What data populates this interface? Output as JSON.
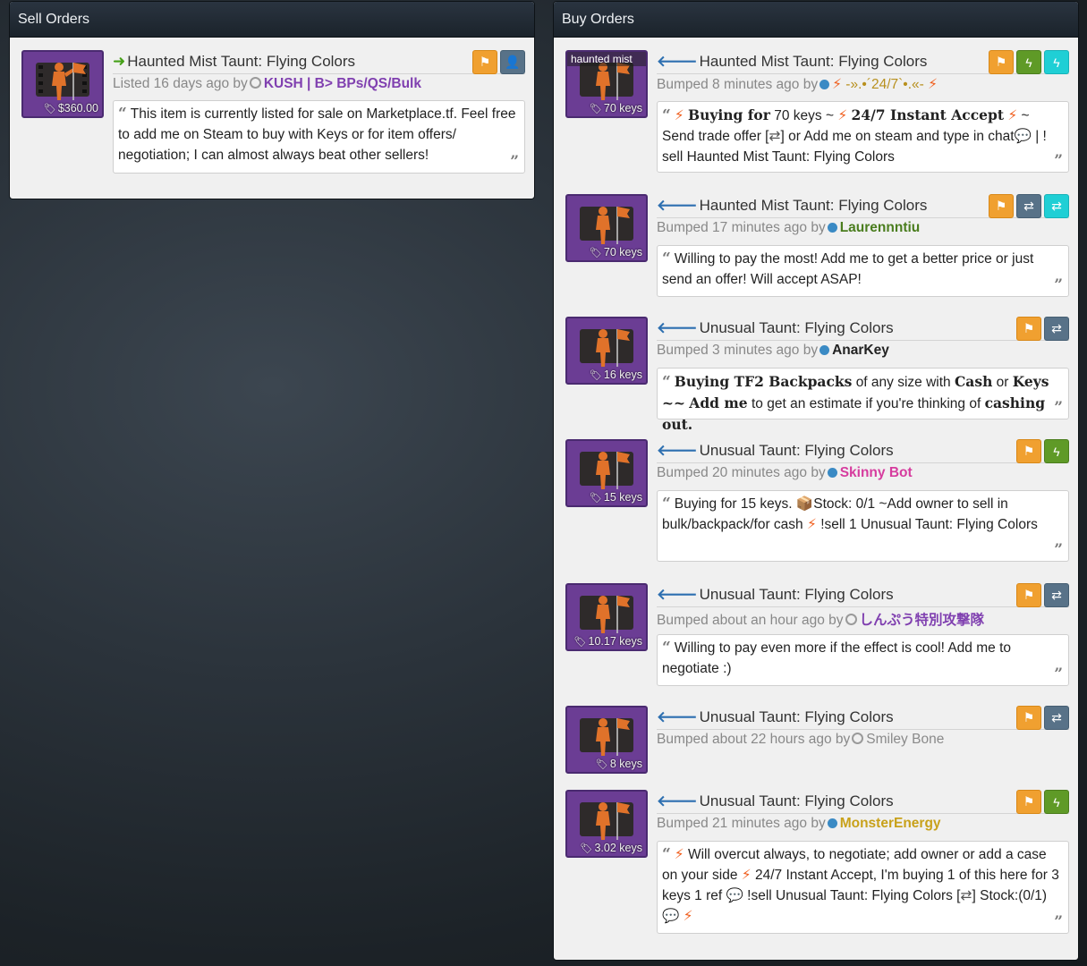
{
  "sell": {
    "header": "Sell Orders",
    "title": "Haunted Mist Taunt: Flying Colors",
    "price": "$360.00",
    "meta_prefix": "Listed 16 days ago by",
    "user": "KUSH | B> BPs/QS/Bulk",
    "description": "This item is currently listed for sale on Marketplace.tf. Feel free to add me on Steam to buy with Keys or for item offers/ negotiation; I can almost always beat other sellers!"
  },
  "buy": {
    "header": "Buy Orders",
    "l1": {
      "effect": "haunted mist",
      "title": "Haunted Mist Taunt: Flying Colors",
      "price": "70 keys",
      "meta_prefix": "Bumped 8 minutes ago by",
      "user": "-».•´24/7`•.«-",
      "d_buying": "Buying for",
      "d_amount": "70 keys ~",
      "d_instant": "24/7 Instant Accept",
      "d_tilde": "~",
      "d_send": "Send trade offer [",
      "d_or": "] or Add me on steam and type in chat",
      "d_bar": "| !",
      "d_sell": "sell Haunted Mist Taunt: Flying Colors"
    },
    "l2": {
      "title": "Haunted Mist Taunt: Flying Colors",
      "price": "70 keys",
      "meta_prefix": "Bumped 17 minutes ago by",
      "user": "Laurennntiu",
      "description": "Willing to pay the most! Add me to get a better price or just send an offer! Will accept ASAP!"
    },
    "l3": {
      "title": "Unusual Taunt: Flying Colors",
      "price": "16 keys",
      "meta_prefix": "Bumped 3 minutes ago by",
      "user": "AnarKey",
      "d_a": "Buying TF2 Backpacks",
      "d_b": "of any size with",
      "d_c": "Cash",
      "d_d": "or",
      "d_e": "Keys ~~",
      "d_f": "Add me",
      "d_g": "to get an estimate if you're thinking of",
      "d_h": "cashing out."
    },
    "l4": {
      "title": "Unusual Taunt: Flying Colors",
      "price": "15 keys",
      "meta_prefix": "Bumped 20 minutes ago by",
      "user": "Skinny Bot",
      "d_a": "Buying for 15 keys.",
      "d_b": "Stock: 0/1 ~Add owner to sell in bulk/backpack/for cash",
      "d_c": "!sell 1 Unusual Taunt: Flying Colors"
    },
    "l5": {
      "title": "Unusual Taunt: Flying Colors",
      "price": "10.17 keys",
      "meta_prefix": "Bumped about an hour ago by",
      "user": "しんぷう特別攻撃隊",
      "description": "Willing to pay even more if the effect is cool! Add me to negotiate :)"
    },
    "l6": {
      "title": "Unusual Taunt: Flying Colors",
      "price": "8 keys",
      "meta_prefix": "Bumped about 22 hours ago by",
      "user": "Smiley Bone"
    },
    "l7": {
      "title": "Unusual Taunt: Flying Colors",
      "price": "3.02 keys",
      "meta_prefix": "Bumped 21 minutes ago by",
      "user": "MonsterEnergy",
      "d_a": "Will overcut always, to negotiate; add owner or add a case on your side",
      "d_b": "24/7 Instant Accept, I'm buying 1 of this here for 3 keys 1 ref",
      "d_c": "!sell Unusual Taunt: Flying Colors [",
      "d_d": "]",
      "d_e": "Stock:(0/1)"
    }
  },
  "icons": [
    "flag-icon",
    "add-user-icon",
    "lightning-icon",
    "swap-icon",
    "tag-icon",
    "quote-icon",
    "arrow-right-icon",
    "arrow-left-icon"
  ],
  "colors": {
    "orange": "#f0a030",
    "slate": "#587288",
    "green": "#5f9a27",
    "cyan": "#1fcfd5",
    "item_bg": "#6b3d94"
  }
}
